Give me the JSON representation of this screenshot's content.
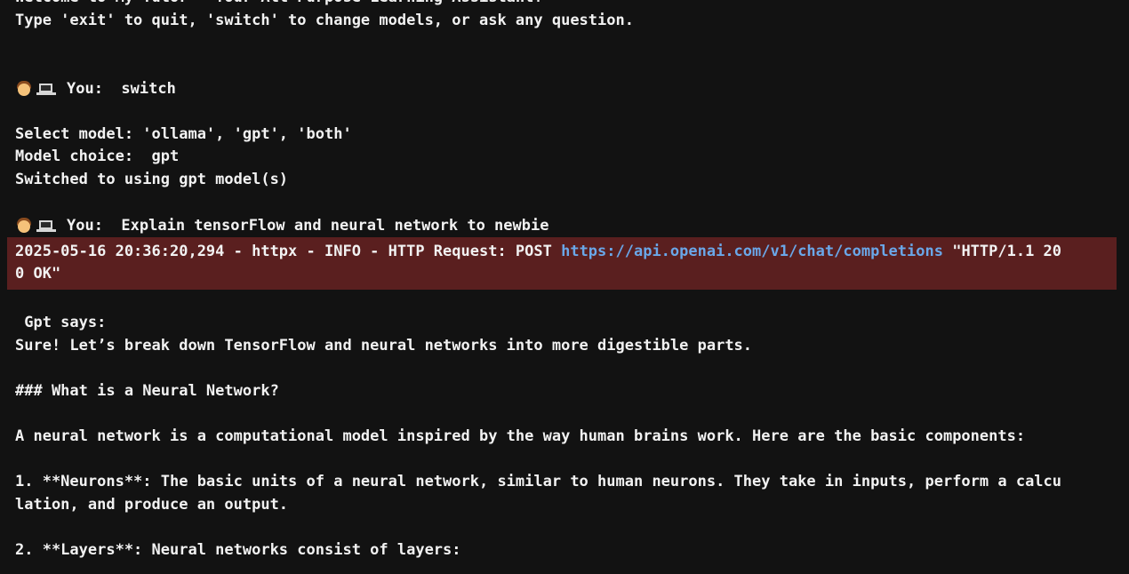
{
  "welcome": {
    "line1": "Welcome to My Tutor - Your All-Purpose Learning Assistant!",
    "line2": "Type 'exit' to quit, 'switch' to change models, or ask any question."
  },
  "turn1": {
    "prompt": "You:  switch"
  },
  "model_select": {
    "line1": "Select model: 'ollama', 'gpt', 'both'",
    "line2": "Model choice:  gpt",
    "line3": "Switched to using gpt model(s)"
  },
  "turn2": {
    "prompt": "You:  Explain tensorFlow and neural network to newbie"
  },
  "log": {
    "prefix": "2025-05-16 20:36:20,294 - httpx - INFO - HTTP Request: POST ",
    "url": "https://api.openai.com/v1/chat/completions",
    "suffix": " \"HTTP/1.1 20",
    "line2": "0 OK\""
  },
  "response": {
    "header": " Gpt says:",
    "intro": "Sure! Let’s break down TensorFlow and neural networks into more digestible parts.",
    "heading": "### What is a Neural Network?",
    "para1": "A neural network is a computational model inspired by the way human brains work. Here are the basic components:",
    "item1_line1": "1. **Neurons**: The basic units of a neural network, similar to human neurons. They take in inputs, perform a calcu",
    "item1_line2": "lation, and produce an output.",
    "item2_line1": "2. **Layers**: Neural networks consist of layers:"
  },
  "icons": {
    "user": "person-icon",
    "computer": "laptop-icon"
  },
  "colors": {
    "background": "#121212",
    "text": "#f2f2f2",
    "log_background": "#5a1f1f",
    "link": "#6aa7e8"
  }
}
